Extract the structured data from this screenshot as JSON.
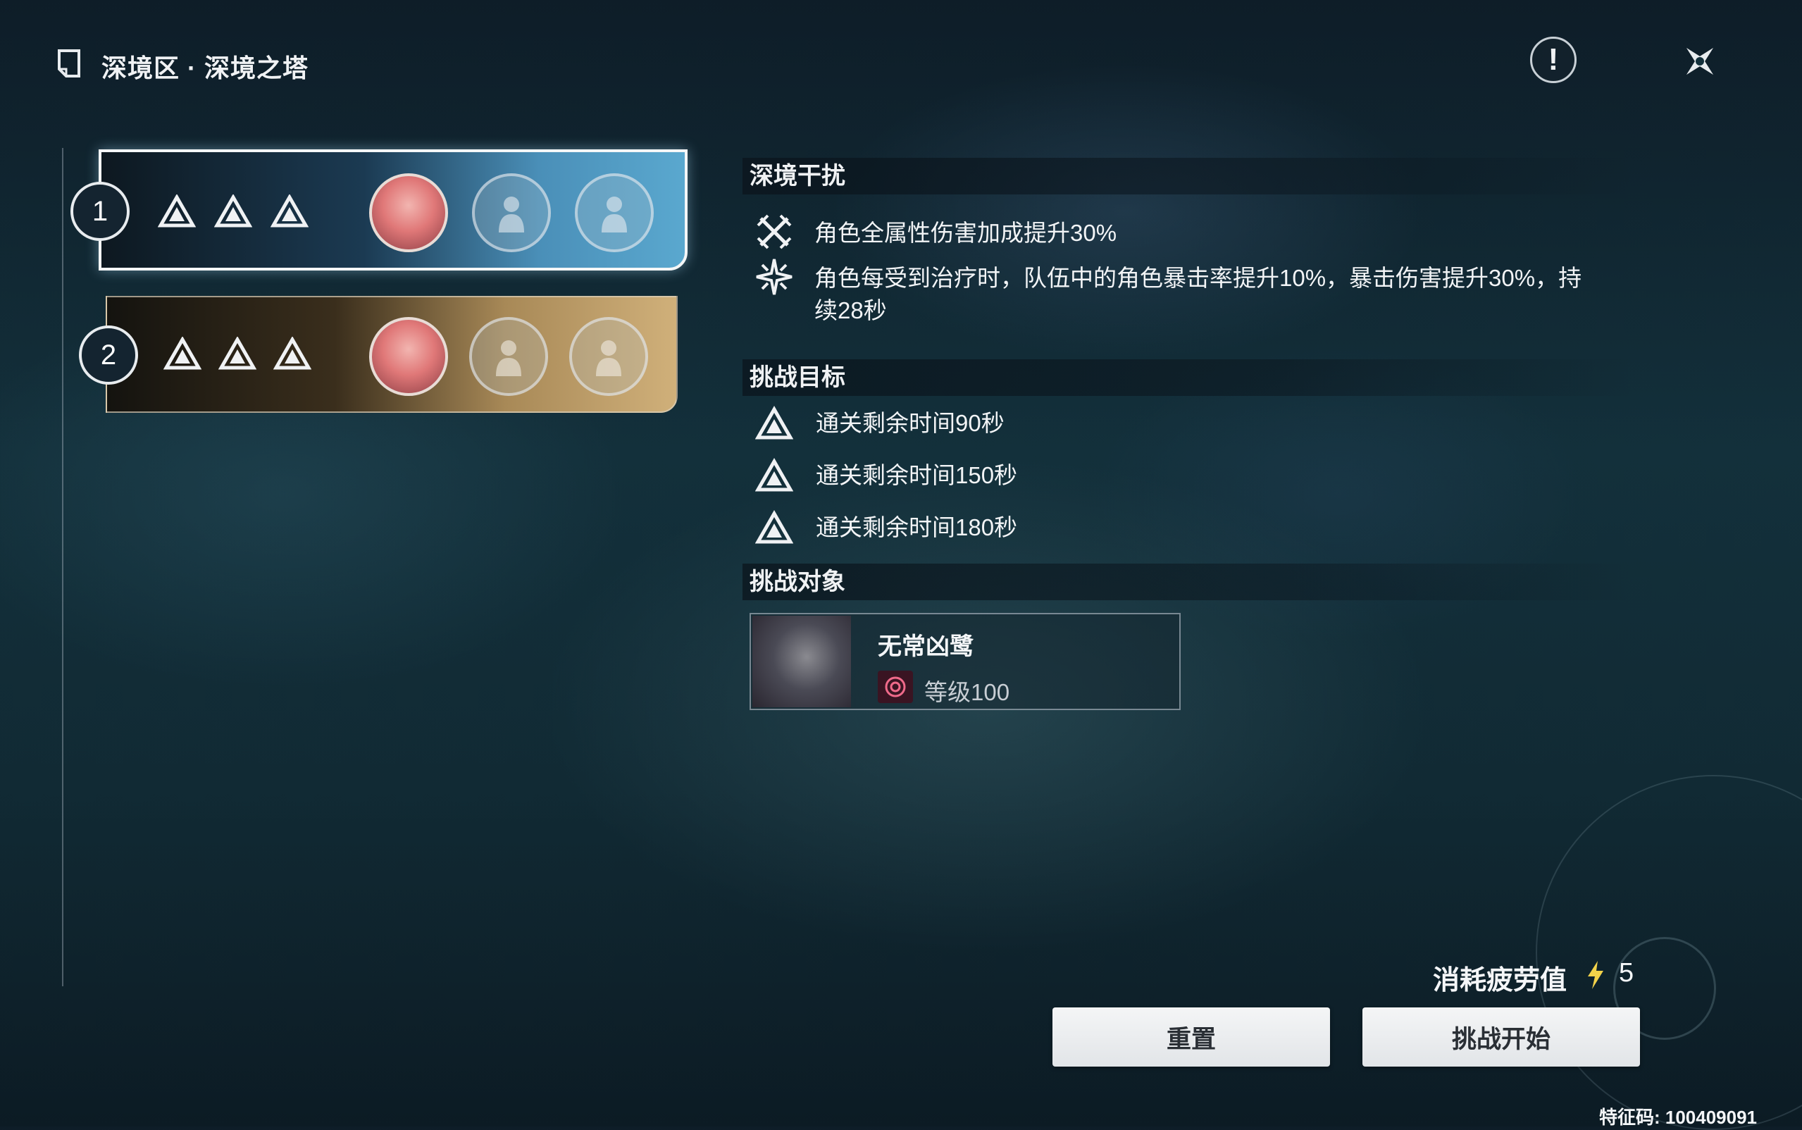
{
  "header": {
    "title": "深境区 · 深境之塔",
    "info_icon": "exclamation-icon",
    "close_icon": "close-icon"
  },
  "stages": [
    {
      "number": "1",
      "stars": 3,
      "portraits": [
        "filled",
        "empty",
        "empty"
      ],
      "selected": true
    },
    {
      "number": "2",
      "stars": 3,
      "portraits": [
        "filled",
        "empty",
        "empty"
      ],
      "selected": false
    }
  ],
  "interference": {
    "title": "深境干扰",
    "items": [
      {
        "icon": "crossed-swords-icon",
        "text": "角色全属性伤害加成提升30%"
      },
      {
        "icon": "sparkle-burst-icon",
        "text_line1": "角色每受到治疗时，队伍中的角色暴击率提升10%，暴击伤害提升30%，持",
        "text_line2": "续28秒"
      }
    ]
  },
  "objectives": {
    "title": "挑战目标",
    "items": [
      {
        "icon": "triangle-emblem-icon",
        "text": "通关剩余时间90秒"
      },
      {
        "icon": "triangle-emblem-icon",
        "text": "通关剩余时间150秒"
      },
      {
        "icon": "triangle-emblem-icon",
        "text": "通关剩余时间180秒"
      }
    ]
  },
  "targets": {
    "title": "挑战对象",
    "enemy": {
      "name": "无常凶鹭",
      "level": "等级100",
      "element_icon": "spiral-element-icon"
    }
  },
  "footer": {
    "fatigue_label": "消耗疲劳值",
    "fatigue_value": "5",
    "reset_label": "重置",
    "start_label": "挑战开始",
    "uid": "特征码: 100409091"
  },
  "colors": {
    "accent_light": "#f4f6f7",
    "stage1_blue": "#4a8fb8",
    "stage2_gold": "#a88957",
    "bolt_yellow": "#f2d24a"
  }
}
